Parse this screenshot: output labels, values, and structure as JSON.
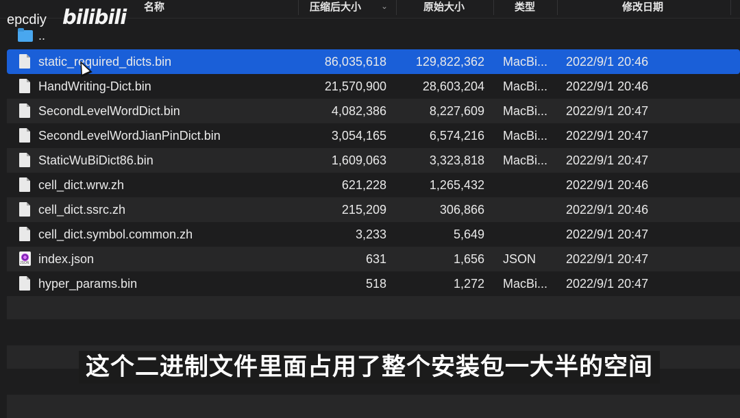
{
  "watermark": {
    "user": "epcdiy",
    "brand": "bilibili"
  },
  "columns": {
    "name": "名称",
    "compressed_size": "压缩后大小",
    "original_size": "原始大小",
    "kind": "类型",
    "modified": "修改日期"
  },
  "parent_row": {
    "label": ".."
  },
  "files": [
    {
      "name": "static_required_dicts.bin",
      "compressed": "86,035,618",
      "original": "129,822,362",
      "kind": "MacBi...",
      "date": "2022/9/1 20:46",
      "icon": "binary-file-icon",
      "selected": true
    },
    {
      "name": "HandWriting-Dict.bin",
      "compressed": "21,570,900",
      "original": "28,603,204",
      "kind": "MacBi...",
      "date": "2022/9/1 20:46",
      "icon": "binary-file-icon"
    },
    {
      "name": "SecondLevelWordDict.bin",
      "compressed": "4,082,386",
      "original": "8,227,609",
      "kind": "MacBi...",
      "date": "2022/9/1 20:47",
      "icon": "binary-file-icon"
    },
    {
      "name": "SecondLevelWordJianPinDict.bin",
      "compressed": "3,054,165",
      "original": "6,574,216",
      "kind": "MacBi...",
      "date": "2022/9/1 20:47",
      "icon": "binary-file-icon"
    },
    {
      "name": "StaticWuBiDict86.bin",
      "compressed": "1,609,063",
      "original": "3,323,818",
      "kind": "MacBi...",
      "date": "2022/9/1 20:47",
      "icon": "binary-file-icon"
    },
    {
      "name": "cell_dict.wrw.zh",
      "compressed": "621,228",
      "original": "1,265,432",
      "kind": "",
      "date": "2022/9/1 20:46",
      "icon": "document-icon"
    },
    {
      "name": "cell_dict.ssrc.zh",
      "compressed": "215,209",
      "original": "306,866",
      "kind": "",
      "date": "2022/9/1 20:46",
      "icon": "document-icon"
    },
    {
      "name": "cell_dict.symbol.common.zh",
      "compressed": "3,233",
      "original": "5,649",
      "kind": "",
      "date": "2022/9/1 20:47",
      "icon": "document-icon"
    },
    {
      "name": "index.json",
      "compressed": "631",
      "original": "1,656",
      "kind": "JSON",
      "date": "2022/9/1 20:47",
      "icon": "json-file-icon"
    },
    {
      "name": "hyper_params.bin",
      "compressed": "518",
      "original": "1,272",
      "kind": "MacBi...",
      "date": "2022/9/1 20:47",
      "icon": "binary-file-icon"
    }
  ],
  "subtitle": "这个二进制文件里面占用了整个安装包一大半的空间",
  "colors": {
    "selection": "#1a5fd8",
    "background": "#1d1d1e",
    "alt_row": "#272728",
    "folder": "#49a7ef"
  }
}
